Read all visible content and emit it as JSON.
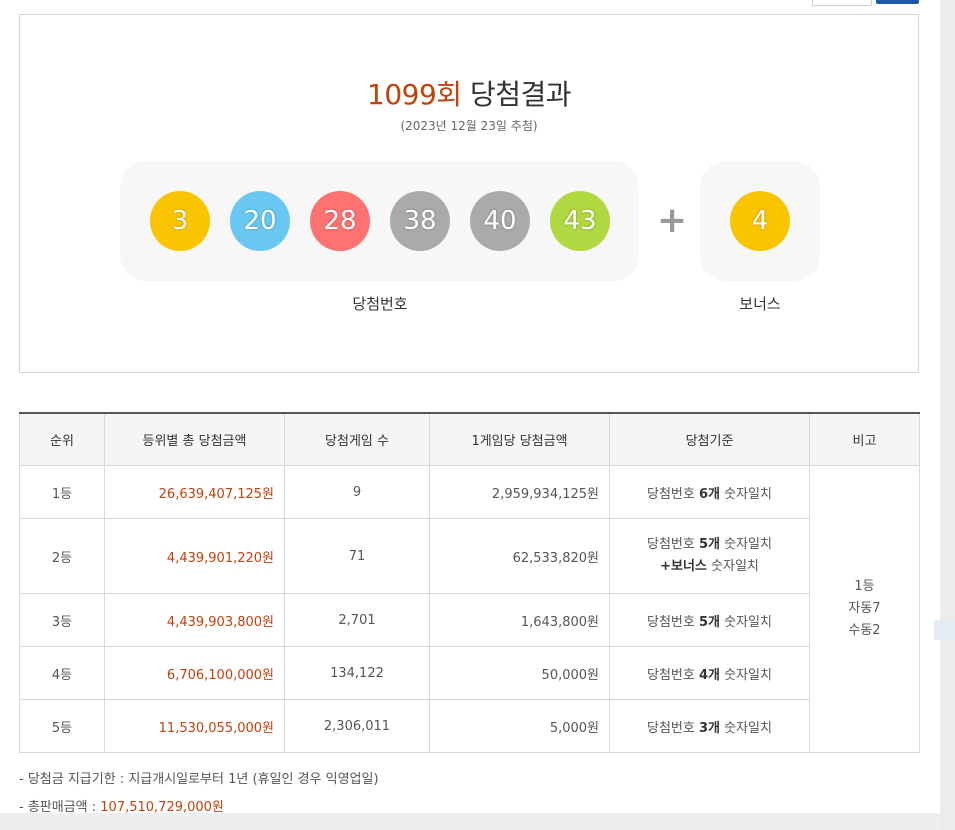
{
  "header": {
    "round": "1099회",
    "title": "당첨결과",
    "date": "(2023년 12월 23일 추첨)"
  },
  "winning_numbers": [
    {
      "value": "3",
      "color": "#fbc400"
    },
    {
      "value": "20",
      "color": "#69c8f2"
    },
    {
      "value": "28",
      "color": "#ff7272"
    },
    {
      "value": "38",
      "color": "#aaaaaa"
    },
    {
      "value": "40",
      "color": "#aaaaaa"
    },
    {
      "value": "43",
      "color": "#b0d840"
    }
  ],
  "plus_sign": "+",
  "bonus_number": {
    "value": "4",
    "color": "#fbc400"
  },
  "labels": {
    "winning": "당첨번호",
    "bonus": "보너스"
  },
  "table": {
    "headers": [
      "순위",
      "등위별 총 당첨금액",
      "당첨게임 수",
      "1게임당 당첨금액",
      "당첨기준",
      "비고"
    ],
    "rows": [
      {
        "rank": "1등",
        "total": "26,639,407,125원",
        "games": "9",
        "per_game": "2,959,934,125원",
        "crit_a": "당첨번호 ",
        "crit_b": "6개",
        "crit_c": " 숫자일치"
      },
      {
        "rank": "2등",
        "total": "4,439,901,220원",
        "games": "71",
        "per_game": "62,533,820원",
        "crit_a": "당첨번호 ",
        "crit_b": "5개",
        "crit_c": " 숫자일치",
        "crit_d": "+보너스",
        "crit_e": " 숫자일치"
      },
      {
        "rank": "3등",
        "total": "4,439,903,800원",
        "games": "2,701",
        "per_game": "1,643,800원",
        "crit_a": "당첨번호 ",
        "crit_b": "5개",
        "crit_c": " 숫자일치"
      },
      {
        "rank": "4등",
        "total": "6,706,100,000원",
        "games": "134,122",
        "per_game": "50,000원",
        "crit_a": "당첨번호 ",
        "crit_b": "4개",
        "crit_c": " 숫자일치"
      },
      {
        "rank": "5등",
        "total": "11,530,055,000원",
        "games": "2,306,011",
        "per_game": "5,000원",
        "crit_a": "당첨번호 ",
        "crit_b": "3개",
        "crit_c": " 숫자일치"
      }
    ],
    "note": {
      "line1": "1등",
      "line2": "자동7",
      "line3": "수동2"
    }
  },
  "footer": {
    "deadline": "-  당첨금 지급기한 : 지급개시일로부터 1년 (휴일인 경우 익영업일)",
    "sales_label": "-  총판매금액 : ",
    "sales_value": "107,510,729,000원"
  },
  "colors": {
    "accent": "#c2410c",
    "button_blue": "#1a5aa8"
  }
}
